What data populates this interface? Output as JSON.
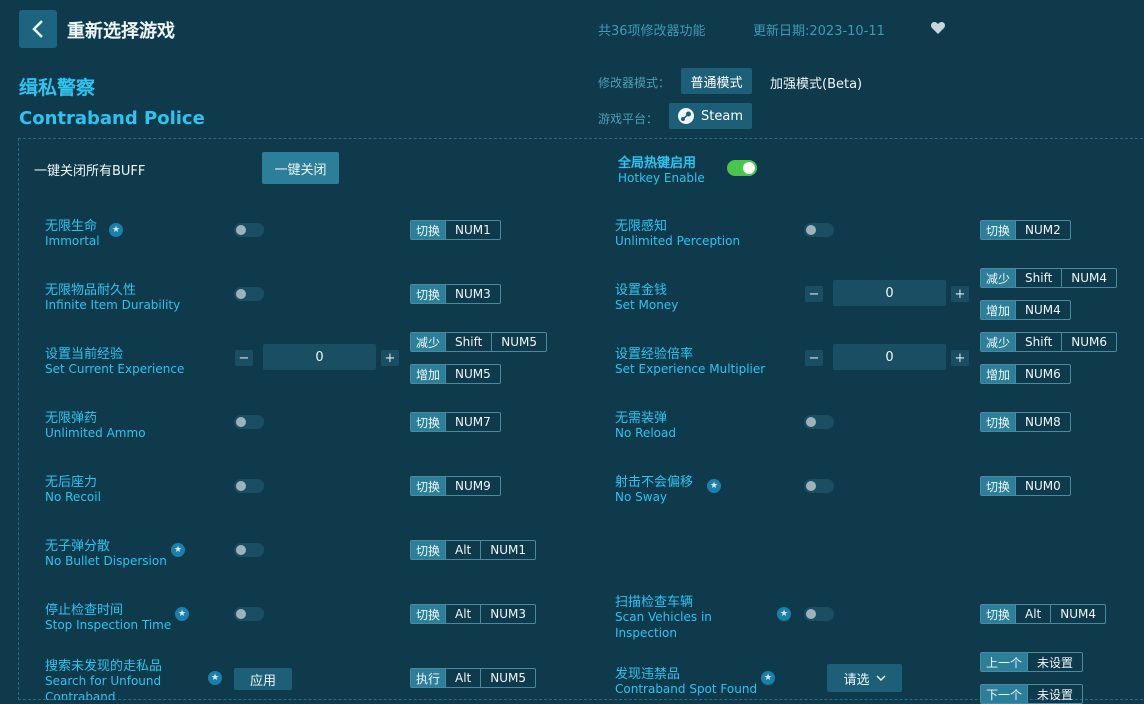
{
  "header": {
    "back_label": "<",
    "title": "重新选择游戏",
    "feature_count": "共36项修改器功能",
    "update_date": "更新日期:2023-10-11"
  },
  "game": {
    "name_cn": "缉私警察",
    "name_en": "Contraband Police"
  },
  "mode": {
    "label": "修改器模式：",
    "normal": "普通模式",
    "enhanced": "加强模式(Beta)"
  },
  "platform": {
    "label": "游戏平台：",
    "steam": "Steam"
  },
  "buff": {
    "label": "一键关闭所有BUFF",
    "button": "一键关闭"
  },
  "hotkey": {
    "cn": "全局热键启用",
    "en": "Hotkey Enable",
    "enabled": true
  },
  "features": {
    "f1": {
      "cn": "无限生命",
      "en": "Immortal",
      "k1": "切换",
      "k2": "NUM1"
    },
    "f2": {
      "cn": "无限感知",
      "en": "Unlimited Perception",
      "k1": "切换",
      "k2": "NUM2"
    },
    "f3": {
      "cn": "无限物品耐久性",
      "en": "Infinite Item Durability",
      "k1": "切换",
      "k2": "NUM3"
    },
    "f4": {
      "cn": "设置金钱",
      "en": "Set Money",
      "value": "0",
      "d1": "减少",
      "d2": "Shift",
      "d3": "NUM4",
      "i1": "增加",
      "i2": "NUM4"
    },
    "f5": {
      "cn": "设置当前经验",
      "en": "Set Current Experience",
      "value": "0",
      "d1": "减少",
      "d2": "Shift",
      "d3": "NUM5",
      "i1": "增加",
      "i2": "NUM5"
    },
    "f6": {
      "cn": "设置经验倍率",
      "en": "Set Experience Multiplier",
      "value": "0",
      "d1": "减少",
      "d2": "Shift",
      "d3": "NUM6",
      "i1": "增加",
      "i2": "NUM6"
    },
    "f7": {
      "cn": "无限弹药",
      "en": "Unlimited Ammo",
      "k1": "切换",
      "k2": "NUM7"
    },
    "f8": {
      "cn": "无需装弹",
      "en": "No Reload",
      "k1": "切换",
      "k2": "NUM8"
    },
    "f9": {
      "cn": "无后座力",
      "en": "No Recoil",
      "k1": "切换",
      "k2": "NUM9"
    },
    "f10": {
      "cn": "射击不会偏移",
      "en": "No Sway",
      "k1": "切换",
      "k2": "NUM0"
    },
    "f11": {
      "cn": "无子弹分散",
      "en": "No Bullet Dispersion",
      "k1": "切换",
      "k2": "Alt",
      "k3": "NUM1"
    },
    "f12": {
      "cn": "停止检查时间",
      "en": "Stop Inspection Time",
      "k1": "切换",
      "k2": "Alt",
      "k3": "NUM3"
    },
    "f13": {
      "cn": "扫描检查车辆",
      "en": "Scan Vehicles in Inspection",
      "k1": "切换",
      "k2": "Alt",
      "k3": "NUM4"
    },
    "f14": {
      "cn": "搜索未发现的走私品",
      "en": "Search for Unfound Contraband",
      "apply": "应用",
      "k1": "执行",
      "k2": "Alt",
      "k3": "NUM5"
    },
    "f15": {
      "cn": "发现违禁品",
      "en": "Contraband Spot Found",
      "select": "请选",
      "p1": "上一个",
      "p2": "未设置",
      "n1": "下一个",
      "n2": "未设置"
    }
  },
  "star_glyph": "★",
  "plus": "+",
  "minus": "−"
}
